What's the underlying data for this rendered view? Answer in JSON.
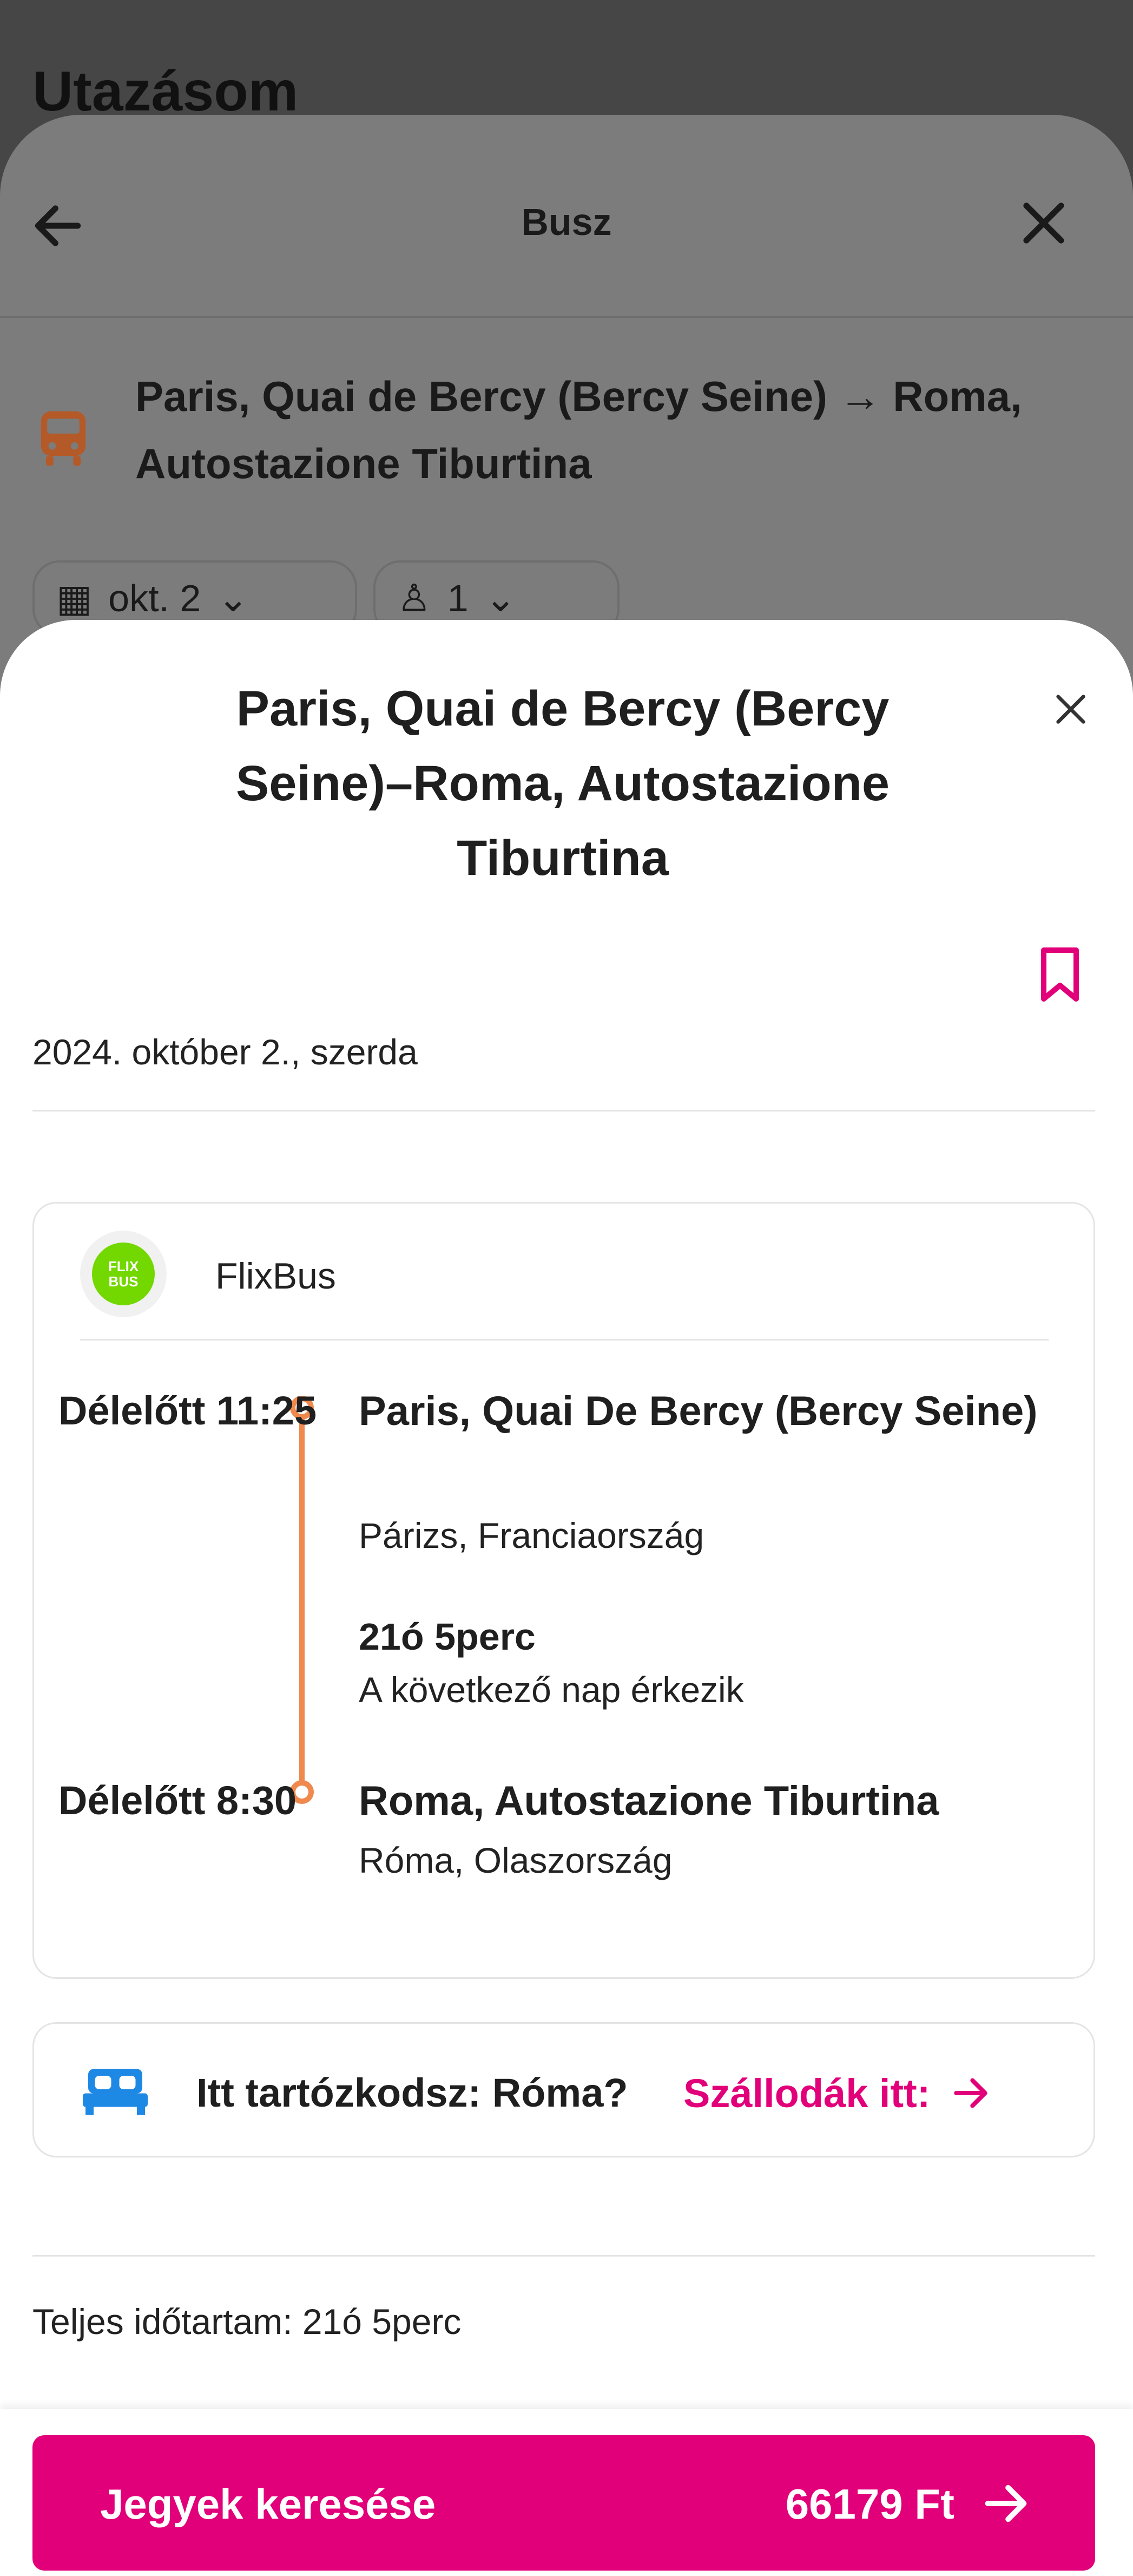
{
  "background": {
    "app_title": "Utazásom",
    "header_title": "Busz",
    "route": "Paris, Quai de Bercy (Bercy Seine) → Roma, Autostazione Tiburtina",
    "date_chip": "okt. 2",
    "passenger_chip": "1"
  },
  "sheet": {
    "title": "Paris, Quai de Bercy (Bercy Seine)–Roma, Autostazione Tiburtina",
    "date": "2024. október 2., szerda",
    "operator": {
      "name": "FlixBus",
      "logo_text_top": "FLIX",
      "logo_text_bottom": "BUS"
    },
    "departure": {
      "time": "Délelőtt 11:25",
      "stop": "Paris, Quai De Bercy (Bercy Seine)",
      "city": "Párizs, Franciaország"
    },
    "duration": "21ó 5perc",
    "next_day_note": "A következő nap érkezik",
    "arrival": {
      "time": "Délelőtt 8:30",
      "stop": "Roma, Autostazione Tiburtina",
      "city": "Róma, Olaszország"
    },
    "hotel": {
      "question": "Itt tartózkodsz: Róma?",
      "link": "Szállodák itt:"
    },
    "total_duration": "Teljes időtartam: 21ó 5perc",
    "cta": {
      "label": "Jegyek keresése",
      "price": "66179 Ft"
    }
  },
  "colors": {
    "accent": "#e2007a",
    "timeline": "#f0894d",
    "bus_icon": "#c4622d",
    "bed_icon": "#1e88e5",
    "flixbus_green": "#73d700"
  }
}
